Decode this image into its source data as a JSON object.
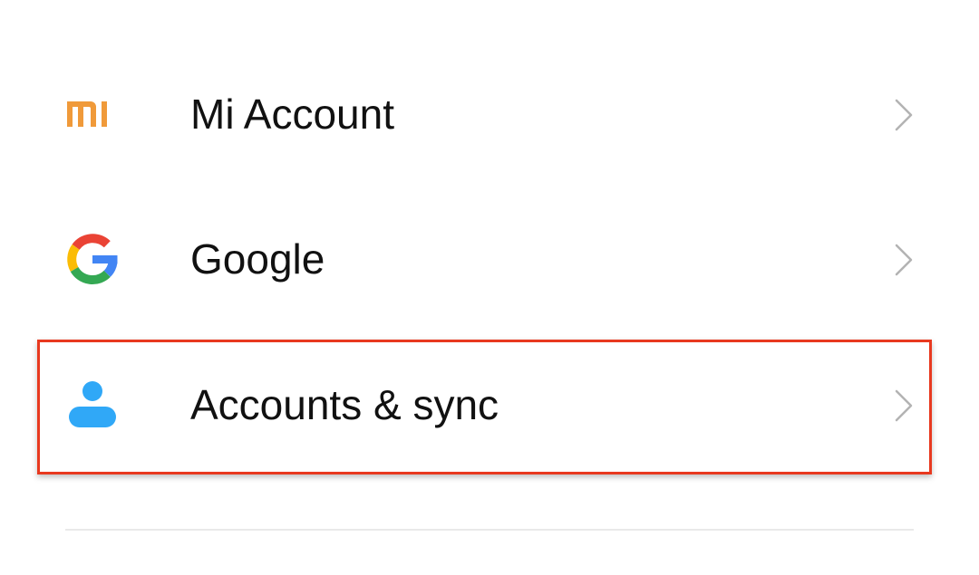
{
  "settings": {
    "items": [
      {
        "label": "Mi Account",
        "icon": "mi-logo-icon",
        "chevron": "chevron-right-icon"
      },
      {
        "label": "Google",
        "icon": "google-g-icon",
        "chevron": "chevron-right-icon"
      },
      {
        "label": "Accounts & sync",
        "icon": "person-icon",
        "chevron": "chevron-right-icon",
        "highlighted": true
      }
    ]
  },
  "colors": {
    "background": "#ffffff",
    "text": "#111111",
    "chevron": "#b3b3b3",
    "mi_orange": "#f09a3a",
    "person_blue": "#30a8f7",
    "highlight_red": "#e8391f",
    "divider": "#e9e9e9"
  }
}
